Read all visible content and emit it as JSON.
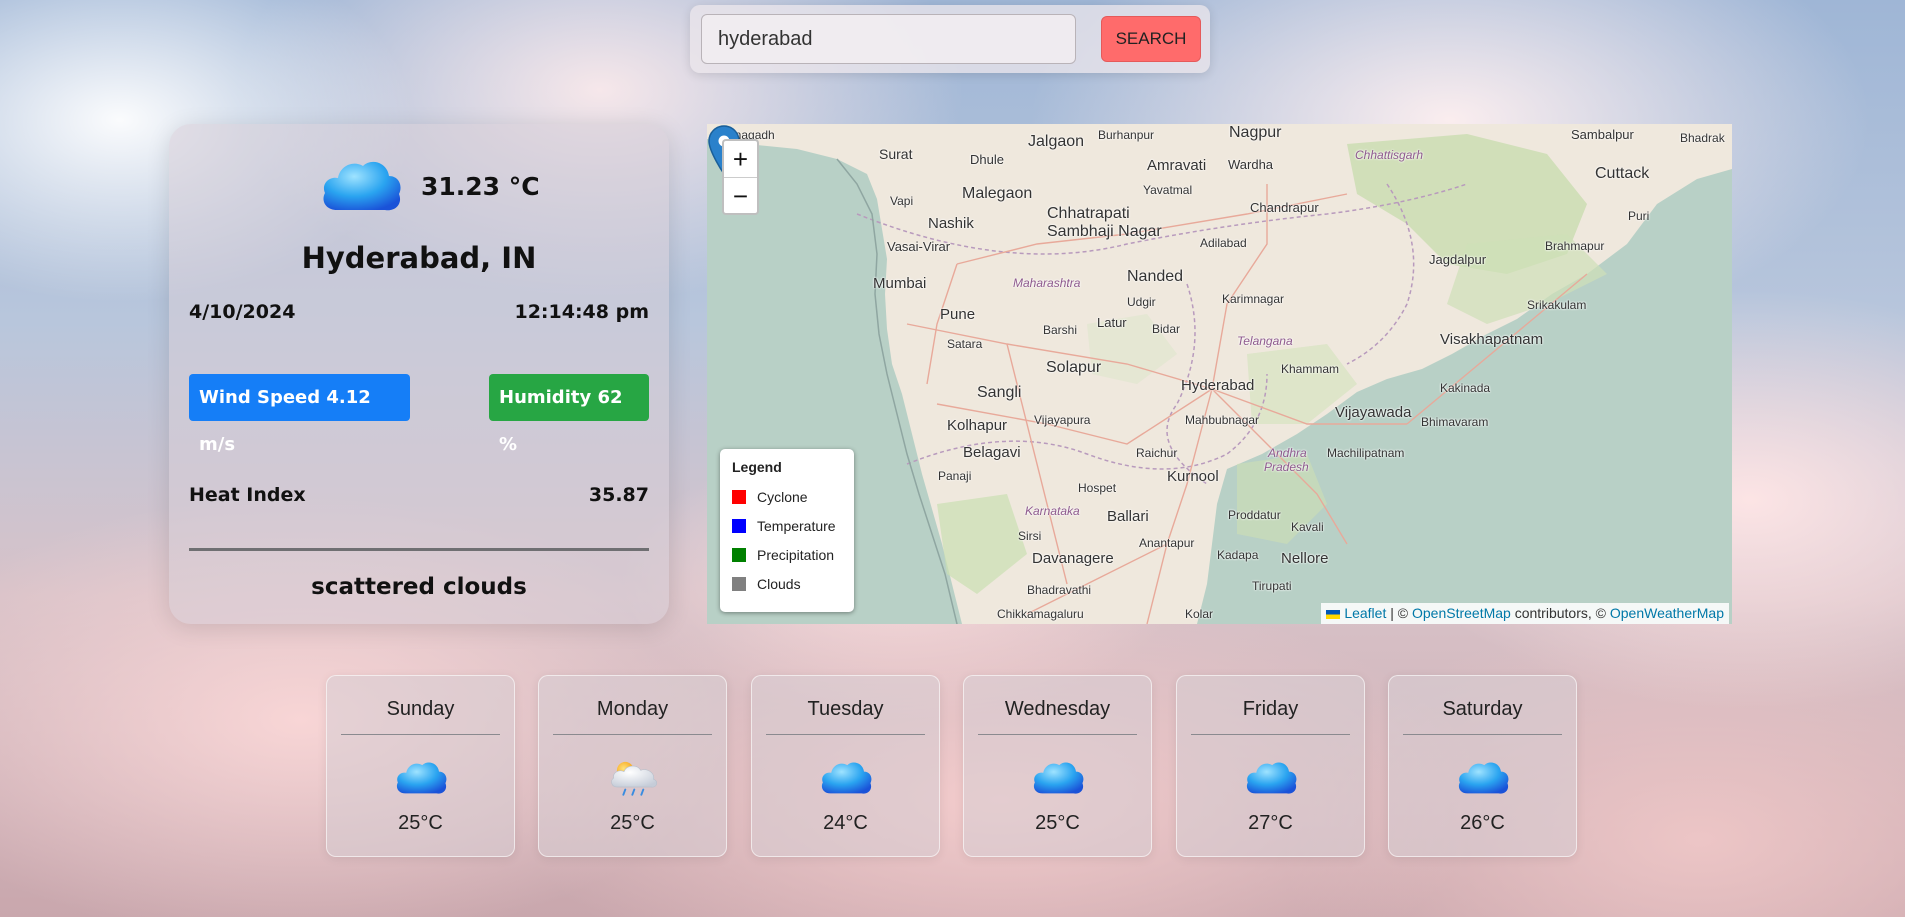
{
  "search": {
    "value": "hyderabad",
    "button_label": "SEARCH"
  },
  "current": {
    "icon": "cloud-icon",
    "temperature": "31.23 °C",
    "city": "Hyderabad, IN",
    "date": "4/10/2024",
    "time": "12:14:48 pm",
    "wind": "Wind Speed 4.12 m/s",
    "humidity": "Humidity 62 %",
    "heat_label": "Heat Index",
    "heat_value": "35.87",
    "description": "scattered clouds",
    "colors": {
      "wind": "#157ef7",
      "humidity": "#27a644"
    }
  },
  "map": {
    "zoom_in": "+",
    "zoom_out": "−",
    "legend": {
      "title": "Legend",
      "items": [
        {
          "label": "Cyclone",
          "color": "#ff0000"
        },
        {
          "label": "Temperature",
          "color": "#0000ff"
        },
        {
          "label": "Precipitation",
          "color": "#008000"
        },
        {
          "label": "Clouds",
          "color": "#808080"
        }
      ]
    },
    "attribution": {
      "leaflet": "Leaflet",
      "sep1": " | © ",
      "osm": "OpenStreetMap",
      "sep2": " contributors, © ",
      "owm": "OpenWeatherMap"
    },
    "places": {
      "junagadh": "Junagadh",
      "surat": "Surat",
      "dhule": "Dhule",
      "jalgaon": "Jalgaon",
      "burhanpur": "Burhanpur",
      "nagpur": "Nagpur",
      "sambalpur": "Sambalpur",
      "bhadrak": "Bhadrak",
      "amravati": "Amravati",
      "wardha": "Wardha",
      "chhattisgarh": "Chhattisgarh",
      "cuttack": "Cuttack",
      "vapi": "Vapi",
      "malegaon": "Malegaon",
      "yavatmal": "Yavatmal",
      "chhatrapati": "Chhatrapati",
      "sambhaji_nagar": "Sambhaji Nagar",
      "nashik": "Nashik",
      "chandrapur": "Chandrapur",
      "puri": "Puri",
      "brahmapur": "Brahmapur",
      "vasai_virar": "Vasai-Virar",
      "adilabad": "Adilabad",
      "jagdalpur": "Jagdalpur",
      "mumbai": "Mumbai",
      "maharashtra": "Maharashtra",
      "nanded": "Nanded",
      "karimnagar": "Karimnagar",
      "srikakulam": "Srikakulam",
      "pune": "Pune",
      "udgir": "Udgir",
      "barshi": "Barshi",
      "latur": "Latur",
      "bidar": "Bidar",
      "telangana": "Telangana",
      "visakhapatnam": "Visakhapatnam",
      "satara": "Satara",
      "solapur": "Solapur",
      "khammam": "Khammam",
      "hyderabad": "Hyderabad",
      "sangli": "Sangli",
      "kakinada": "Kakinada",
      "kolhapur": "Kolhapur",
      "vijayapura": "Vijayapura",
      "mahbubnagar": "Mahbubnagar",
      "vijayawada": "Vijayawada",
      "bhimavaram": "Bhimavaram",
      "belagavi": "Belagavi",
      "raichur": "Raichur",
      "andhra": "Andhra",
      "pradesh": "Pradesh",
      "machilipatnam": "Machilipatnam",
      "panaji": "Panaji",
      "kurnool": "Kurnool",
      "hospet": "Hospet",
      "karnataka": "Karnataka",
      "ballari": "Ballari",
      "proddatur": "Proddatur",
      "kavali": "Kavali",
      "sirsi": "Sirsi",
      "anantapur": "Anantapur",
      "davanagere": "Davanagere",
      "kadapa": "Kadapa",
      "nellore": "Nellore",
      "bhadravathi": "Bhadravathi",
      "tirupati": "Tirupati",
      "chikkamagaluru": "Chikkamagaluru",
      "kolar": "Kolar"
    }
  },
  "forecast": [
    {
      "day": "Sunday",
      "temp": "25°C",
      "icon": "cloud-icon"
    },
    {
      "day": "Monday",
      "temp": "25°C",
      "icon": "sun-rain-cloud-icon"
    },
    {
      "day": "Tuesday",
      "temp": "24°C",
      "icon": "cloud-icon"
    },
    {
      "day": "Wednesday",
      "temp": "25°C",
      "icon": "cloud-icon"
    },
    {
      "day": "Friday",
      "temp": "27°C",
      "icon": "cloud-icon"
    },
    {
      "day": "Saturday",
      "temp": "26°C",
      "icon": "cloud-icon"
    }
  ]
}
